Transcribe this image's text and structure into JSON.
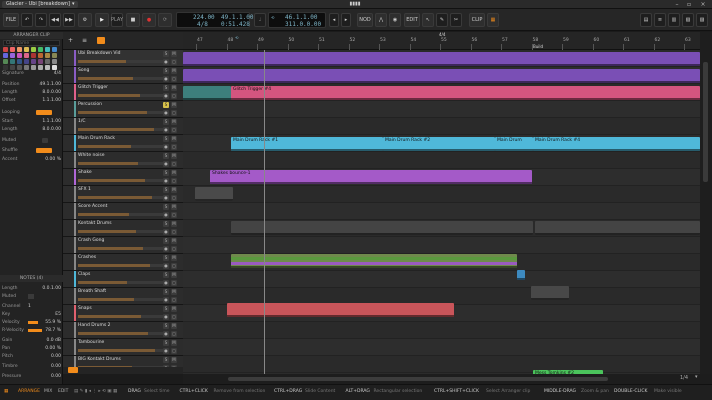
{
  "window": {
    "title": "Glacier - Ubi [breakdown]"
  },
  "toolbar": {
    "file": "FILE",
    "play": "PLAY",
    "tempo": "224.00",
    "signature": "4/8",
    "position": "49.1.1.00",
    "time": "0:51.428",
    "loop_start": "46.1.1.00",
    "loop_length": "311.0.0.00",
    "nod": "NOD",
    "edit": "EDIT",
    "clip": "CLIP"
  },
  "inspector": {
    "arranger_clip_title": "ARRANGER CLIP",
    "clip_name_placeholder": "Clip Name",
    "signature_label": "Signature",
    "signature_value": "4/4",
    "position_label": "Position",
    "position_value": "49.1.1.00",
    "length_label": "Length",
    "length_value": "8.0.0.00",
    "offset_label": "Offset",
    "offset_value": "1.1.1.00",
    "looping_label": "Looping",
    "start_label": "Start",
    "start_value": "1.1.1.00",
    "loop_length_label": "Length",
    "loop_length_value": "8.0.0.00",
    "muted_label": "Muted",
    "shuffle_label": "Shuffle",
    "accent_label": "Accent",
    "accent_value": "0.00 %",
    "notes_title": "NOTES (4)",
    "n_length_label": "Length",
    "n_length_value": "0.0.1.00",
    "n_muted_label": "Muted",
    "channel_label": "Channel",
    "channel_value": "1",
    "key_label": "Key",
    "key_value": "E5",
    "velocity_label": "Velocity",
    "velocity_value": "55.9 %",
    "rvelocity_label": "R-Velocity",
    "rvelocity_value": "78.7 %",
    "gain_label": "Gain",
    "gain_value": "0.0 dB",
    "pan_label": "Pan",
    "pan_value": "0.00 %",
    "pitch_label": "Pitch",
    "pitch_value": "0.00",
    "timbre_label": "Timbre",
    "timbre_value": "0.00",
    "pressure_label": "Pressure",
    "pressure_value": "0.00"
  },
  "tracks": [
    {
      "name": "Ubi Breakdown Vid",
      "color": "#8a5cc4"
    },
    {
      "name": "Song",
      "color": "#8a5cc4"
    },
    {
      "name": "Glitch Trigger",
      "color": "#e0608a"
    },
    {
      "name": "Percussion",
      "color": "#5a9d9a",
      "solo": true
    },
    {
      "name": "1/C",
      "color": "#888888"
    },
    {
      "name": "Main Drum Rack",
      "color": "#4fb8d9"
    },
    {
      "name": "White noise",
      "color": "#888888"
    },
    {
      "name": "Shake",
      "color": "#b066d6"
    },
    {
      "name": "SFX 1",
      "color": "#888888"
    },
    {
      "name": "Score Accent",
      "color": "#888888"
    },
    {
      "name": "Kontakt Drums",
      "color": "#888888"
    },
    {
      "name": "Crash Gong",
      "color": "#888888"
    },
    {
      "name": "Crashes",
      "color": "#888888"
    },
    {
      "name": "Claps",
      "color": "#4fb8d9"
    },
    {
      "name": "Breath Shaft",
      "color": "#888888"
    },
    {
      "name": "Snaps",
      "color": "#e0606e"
    },
    {
      "name": "Hand Drums 2",
      "color": "#888888"
    },
    {
      "name": "Tambourine",
      "color": "#888888"
    },
    {
      "name": "BIG Kontakt Drums",
      "color": "#888888"
    },
    {
      "name": "Live End Impact",
      "color": "#5bd16a"
    }
  ],
  "ruler": {
    "bars": [
      "47",
      "48",
      "49",
      "50",
      "51",
      "52",
      "53",
      "54",
      "55",
      "56",
      "57",
      "58",
      "59",
      "60",
      "61",
      "62",
      "63",
      "64"
    ],
    "signature_marker": "4/4",
    "build_marker": "Build"
  },
  "clips": [
    {
      "name": "Glitch Trigger #4",
      "color": "#e0608a"
    },
    {
      "name": "Main Drum Rack #1",
      "color": "#4fb8d9"
    },
    {
      "name": "Main Drum Rack #2",
      "color": "#4fb8d9"
    },
    {
      "name": "Main Drum",
      "color": "#4fb8d9"
    },
    {
      "name": "Main Drum Rack #4",
      "color": "#4fb8d9"
    },
    {
      "name": "Shakes bounce-1",
      "color": "#b066d6"
    },
    {
      "name": "Mess Tomkins #2",
      "color": "#5bd16a"
    }
  ],
  "zoom": "1/4",
  "status": {
    "mode": "ARRANGE",
    "mix": "MIX",
    "edit": "EDIT",
    "hints": [
      {
        "key": "DRAG",
        "text": "Select time"
      },
      {
        "key": "CTRL+CLICK",
        "text": "Remove from selection"
      },
      {
        "key": "CTRL+DRAG",
        "text": "Slide Content"
      },
      {
        "key": "ALT+DRAG",
        "text": "Rectangular selection"
      },
      {
        "key": "CTRL+SHIFT+CLICK",
        "text": "Select Arranger clip"
      },
      {
        "key": "MIDDLE-DRAG",
        "text": "Zoom & pan"
      },
      {
        "key": "DOUBLE-CLICK",
        "text": "Make visible"
      }
    ]
  },
  "colors": {
    "accent": "#f28c1b",
    "purple": "#8a5cc4",
    "cyan": "#4fb8d9",
    "pink": "#e0608a"
  }
}
